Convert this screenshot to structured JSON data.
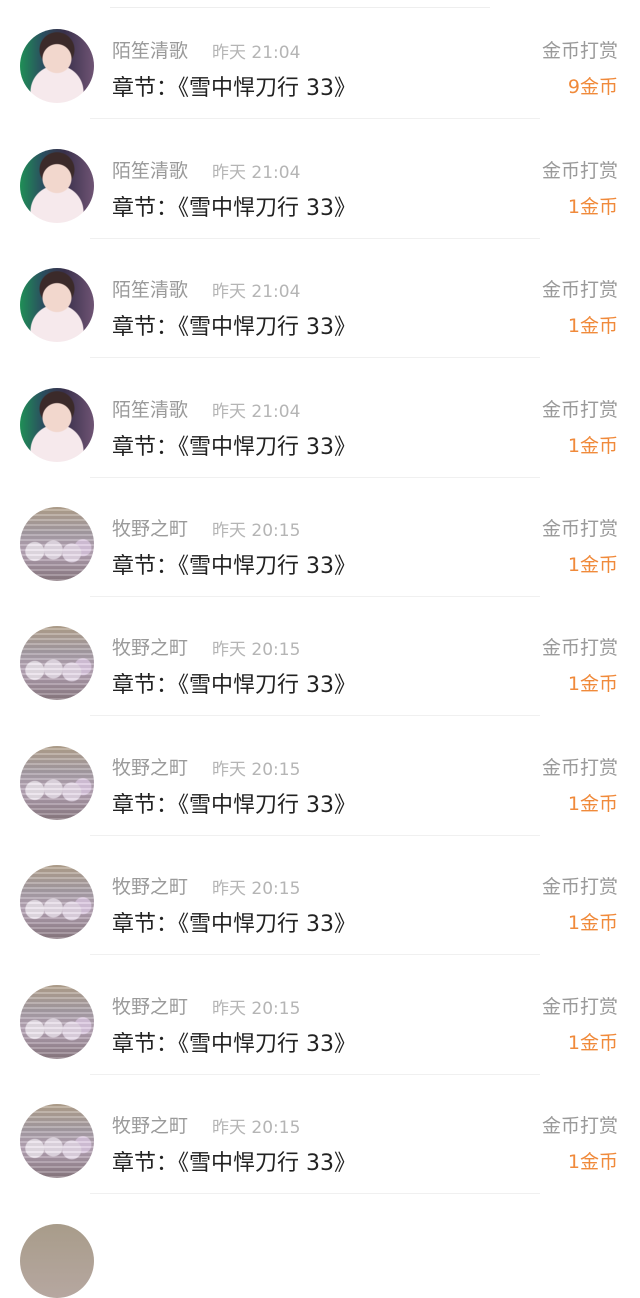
{
  "items": [
    {
      "user": "陌笙清歌",
      "time": "昨天 21:04",
      "chapter": "章节：《雪中悍刀行 33》",
      "reward_label": "金币打赏",
      "amount": "9金币",
      "avatar": "avatar-young-man-green-bg"
    },
    {
      "user": "陌笙清歌",
      "time": "昨天 21:04",
      "chapter": "章节：《雪中悍刀行 33》",
      "reward_label": "金币打赏",
      "amount": "1金币",
      "avatar": "avatar-young-man-green-bg"
    },
    {
      "user": "陌笙清歌",
      "time": "昨天 21:04",
      "chapter": "章节：《雪中悍刀行 33》",
      "reward_label": "金币打赏",
      "amount": "1金币",
      "avatar": "avatar-young-man-green-bg"
    },
    {
      "user": "陌笙清歌",
      "time": "昨天 21:04",
      "chapter": "章节：《雪中悍刀行 33》",
      "reward_label": "金币打赏",
      "amount": "1金币",
      "avatar": "avatar-young-man-green-bg"
    },
    {
      "user": "牧野之町",
      "time": "昨天 20:15",
      "chapter": "章节：《雪中悍刀行 33》",
      "reward_label": "金币打赏",
      "amount": "1金币",
      "avatar": "avatar-kittens-row"
    },
    {
      "user": "牧野之町",
      "time": "昨天 20:15",
      "chapter": "章节：《雪中悍刀行 33》",
      "reward_label": "金币打赏",
      "amount": "1金币",
      "avatar": "avatar-kittens-row"
    },
    {
      "user": "牧野之町",
      "time": "昨天 20:15",
      "chapter": "章节：《雪中悍刀行 33》",
      "reward_label": "金币打赏",
      "amount": "1金币",
      "avatar": "avatar-kittens-row"
    },
    {
      "user": "牧野之町",
      "time": "昨天 20:15",
      "chapter": "章节：《雪中悍刀行 33》",
      "reward_label": "金币打赏",
      "amount": "1金币",
      "avatar": "avatar-kittens-row"
    },
    {
      "user": "牧野之町",
      "time": "昨天 20:15",
      "chapter": "章节：《雪中悍刀行 33》",
      "reward_label": "金币打赏",
      "amount": "1金币",
      "avatar": "avatar-kittens-row"
    },
    {
      "user": "牧野之町",
      "time": "昨天 20:15",
      "chapter": "章节：《雪中悍刀行 33》",
      "reward_label": "金币打赏",
      "amount": "1金币",
      "avatar": "avatar-kittens-row"
    }
  ],
  "colors": {
    "amount": "#f08a3b",
    "secondary_text": "#9a9a9a",
    "primary_text": "#222222",
    "divider": "#f0f0f0"
  }
}
